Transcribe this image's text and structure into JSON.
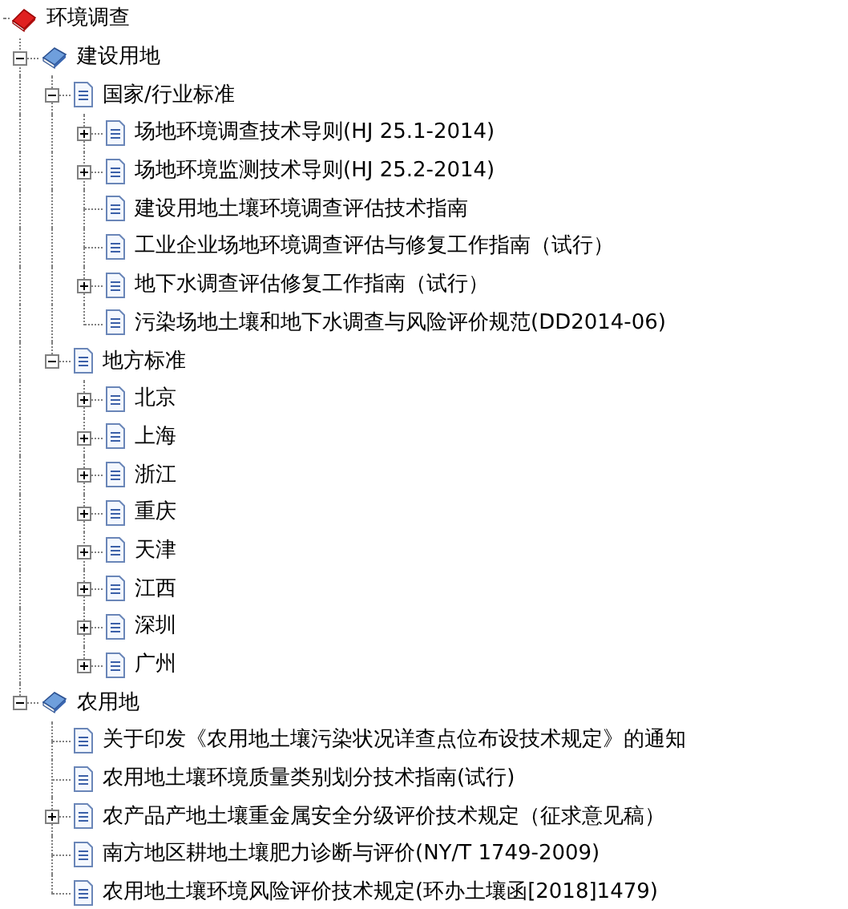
{
  "tree": [
    {
      "kind": "root",
      "label": "环境调查",
      "children": [
        {
          "kind": "category",
          "label": "建设用地",
          "expanded": true,
          "children": [
            {
              "kind": "document",
              "label": "国家/行业标准",
              "expanded": true,
              "children": [
                {
                  "kind": "document",
                  "label": "场地环境调查技术导则(HJ 25.1-2014)",
                  "expanded": false
                },
                {
                  "kind": "document",
                  "label": "场地环境监测技术导则(HJ 25.2-2014)",
                  "expanded": false
                },
                {
                  "kind": "document",
                  "label": "建设用地土壤环境调查评估技术指南"
                },
                {
                  "kind": "document",
                  "label": "工业企业场地环境调查评估与修复工作指南（试行）"
                },
                {
                  "kind": "document",
                  "label": "地下水调查评估修复工作指南（试行）",
                  "expanded": false
                },
                {
                  "kind": "document",
                  "label": "污染场地土壤和地下水调查与风险评价规范(DD2014-06)"
                }
              ]
            },
            {
              "kind": "document",
              "label": "地方标准",
              "expanded": true,
              "children": [
                {
                  "kind": "document",
                  "label": "北京",
                  "expanded": false
                },
                {
                  "kind": "document",
                  "label": "上海",
                  "expanded": false
                },
                {
                  "kind": "document",
                  "label": "浙江",
                  "expanded": false
                },
                {
                  "kind": "document",
                  "label": "重庆",
                  "expanded": false
                },
                {
                  "kind": "document",
                  "label": "天津",
                  "expanded": false
                },
                {
                  "kind": "document",
                  "label": "江西",
                  "expanded": false
                },
                {
                  "kind": "document",
                  "label": "深圳",
                  "expanded": false
                },
                {
                  "kind": "document",
                  "label": "广州",
                  "expanded": false
                }
              ]
            }
          ]
        },
        {
          "kind": "category",
          "label": "农用地",
          "expanded": true,
          "children": [
            {
              "kind": "document",
              "label": "关于印发《农用地土壤污染状况详查点位布设技术规定》的通知"
            },
            {
              "kind": "document",
              "label": "农用地土壤环境质量类别划分技术指南(试行)"
            },
            {
              "kind": "document",
              "label": "农产品产地土壤重金属安全分级评价技术规定（征求意见稿）",
              "expanded": false
            },
            {
              "kind": "document",
              "label": "南方地区耕地土壤肥力诊断与评价(NY/T 1749-2009)"
            },
            {
              "kind": "document",
              "label": "农用地土壤环境风险评价技术规定(环办土壤函[2018]1479)"
            }
          ]
        }
      ]
    }
  ]
}
